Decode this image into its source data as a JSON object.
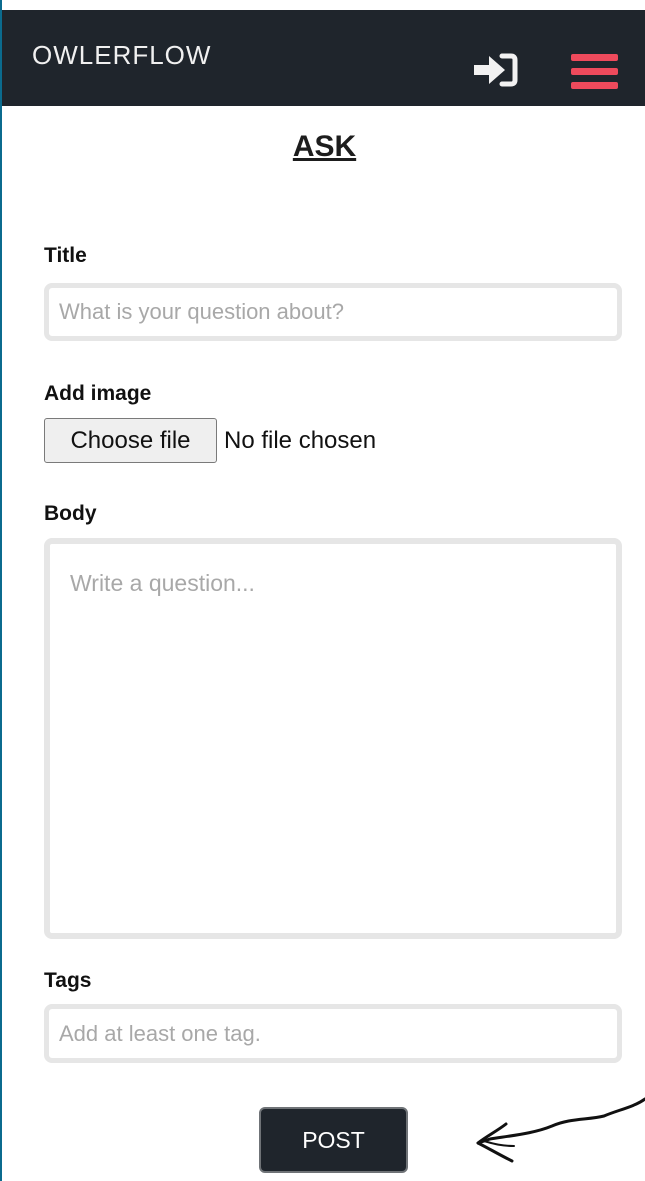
{
  "header": {
    "brand": "OWLERFLOW",
    "login_icon": "sign-in-icon",
    "menu_icon": "hamburger-menu-icon",
    "menu_color": "#ee4a5c",
    "background": "#1f252c"
  },
  "page": {
    "title": "ASK"
  },
  "form": {
    "title_label": "Title",
    "title_placeholder": "What is your question about?",
    "image_label": "Add image",
    "file_button": "Choose file",
    "file_status": "No file chosen",
    "body_label": "Body",
    "body_placeholder": "Write a question...",
    "tags_label": "Tags",
    "tags_placeholder": "Add at least one tag.",
    "post_label": "POST"
  }
}
